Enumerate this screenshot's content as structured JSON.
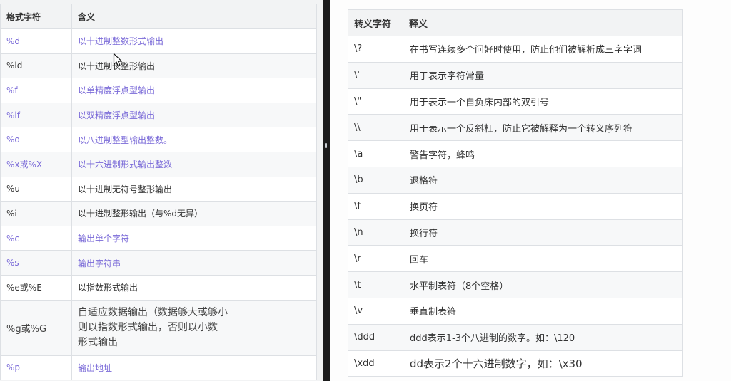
{
  "colors": {
    "link": "#7a6ad8",
    "text": "#333333",
    "header_bg": "#f2f3f4",
    "stripe_bg": "#f7f8f9",
    "border": "#dde0e4",
    "divider": "#1c1c1c"
  },
  "format_table": {
    "headers": [
      "格式字符",
      "含义"
    ],
    "rows": [
      {
        "spec": "%d",
        "meaning": "以十进制整数形式输出",
        "link": true
      },
      {
        "spec": "%ld",
        "meaning": "以十进制长整形输出",
        "link": false
      },
      {
        "spec": "%f",
        "meaning": "以单精度浮点型输出",
        "link": true
      },
      {
        "spec": "%lf",
        "meaning": "以双精度浮点型输出",
        "link": true
      },
      {
        "spec": "%o",
        "meaning": "以八进制整型输出整数。",
        "link": true
      },
      {
        "spec": "%x或%X",
        "meaning": "以十六进制形式输出整数",
        "link": true
      },
      {
        "spec": "%u",
        "meaning": "以十进制无符号整形输出",
        "link": false
      },
      {
        "spec": "%i",
        "meaning": "以十进制整形输出（与%d无异）",
        "link": false
      },
      {
        "spec": "%c",
        "meaning": "输出单个字符",
        "link": true
      },
      {
        "spec": "%s",
        "meaning": "输出字符串",
        "link": true
      },
      {
        "spec": "%e或%E",
        "meaning": "以指数形式输出",
        "link": false
      },
      {
        "spec": "%g或%G",
        "meaning": [
          "自适应数据输出（数据够大或够小",
          "则以指数形式输出，否则以小数",
          "形式输出"
        ],
        "link": false
      },
      {
        "spec": "%p",
        "meaning": "输出地址",
        "link": true
      }
    ]
  },
  "escape_table": {
    "headers": [
      "转义字符",
      "释义"
    ],
    "rows": [
      {
        "char": "\\?",
        "meaning": "在书写连续多个问好时使用，防止他们被解析成三字字词"
      },
      {
        "char": "\\'",
        "meaning": "用于表示字符常量"
      },
      {
        "char": "\\\"",
        "meaning": "用于表示一个自负床内部的双引号"
      },
      {
        "char": "\\\\",
        "meaning": "用于表示一个反斜杠，防止它被解释为一个转义序列符"
      },
      {
        "char": "\\a",
        "meaning": "警告字符，蜂鸣"
      },
      {
        "char": "\\b",
        "meaning": "退格符"
      },
      {
        "char": "\\f",
        "meaning": "换页符"
      },
      {
        "char": "\\n",
        "meaning": "换行符"
      },
      {
        "char": "\\r",
        "meaning": "回车"
      },
      {
        "char": "\\t",
        "meaning": "水平制表符（8个空格）"
      },
      {
        "char": "\\v",
        "meaning": "垂直制表符"
      },
      {
        "char": "\\ddd",
        "meaning": "ddd表示1-3个八进制的数字。如：\\120"
      },
      {
        "char": "\\xdd",
        "meaning": "dd表示2个十六进制数字，如：\\x30"
      }
    ]
  }
}
